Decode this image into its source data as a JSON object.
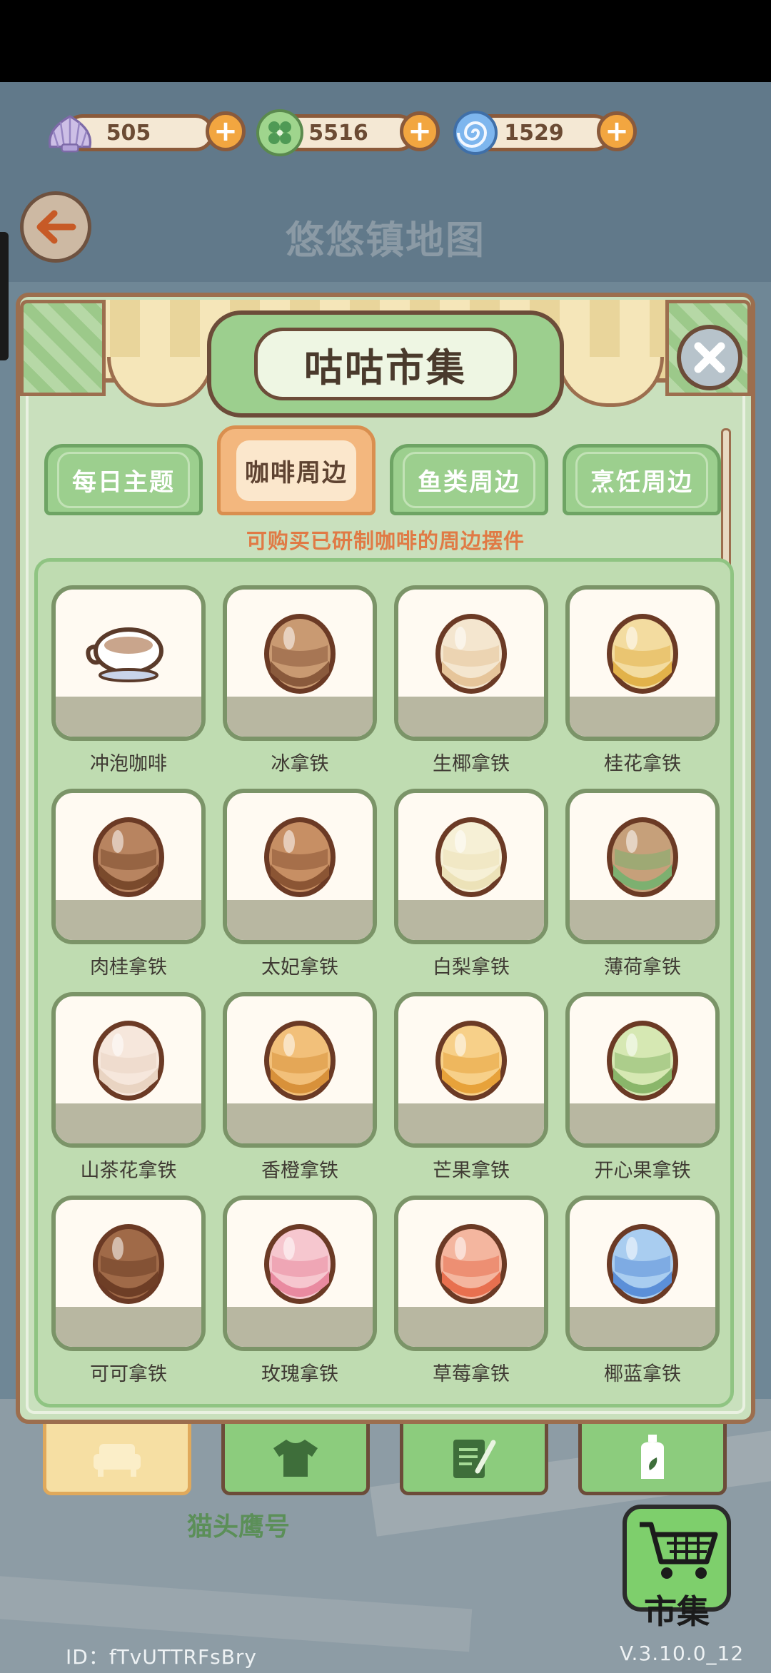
{
  "currencies": [
    {
      "name": "shell",
      "value": "505"
    },
    {
      "name": "clover",
      "value": "5516"
    },
    {
      "name": "swirl",
      "value": "1529"
    }
  ],
  "header": {
    "title": "悠悠镇地图"
  },
  "market": {
    "title": "咕咕市集",
    "tabs": [
      {
        "label": "每日主题",
        "active": false
      },
      {
        "label": "咖啡周边",
        "active": true
      },
      {
        "label": "鱼类周边",
        "active": false
      },
      {
        "label": "烹饪周边",
        "active": false
      }
    ],
    "subtitle": "可购买已研制咖啡的周边摆件",
    "items": [
      {
        "name": "冲泡咖啡"
      },
      {
        "name": "冰拿铁"
      },
      {
        "name": "生椰拿铁"
      },
      {
        "name": "桂花拿铁"
      },
      {
        "name": "肉桂拿铁"
      },
      {
        "name": "太妃拿铁"
      },
      {
        "name": "白梨拿铁"
      },
      {
        "name": "薄荷拿铁"
      },
      {
        "name": "山茶花拿铁"
      },
      {
        "name": "香橙拿铁"
      },
      {
        "name": "芒果拿铁"
      },
      {
        "name": "开心果拿铁"
      },
      {
        "name": "可可拿铁"
      },
      {
        "name": "玫瑰拿铁"
      },
      {
        "name": "草莓拿铁"
      },
      {
        "name": "椰蓝拿铁"
      }
    ]
  },
  "footer": {
    "owl_label": "猫头鹰号",
    "market_button": "市集",
    "user_id": "ID：fTvUTTRFsBry",
    "version": "V.3.10.0_12"
  },
  "colors": {
    "panel": "#c9e0bd",
    "accent_tab": "#f3b77e",
    "subtitle": "#e07a45"
  }
}
